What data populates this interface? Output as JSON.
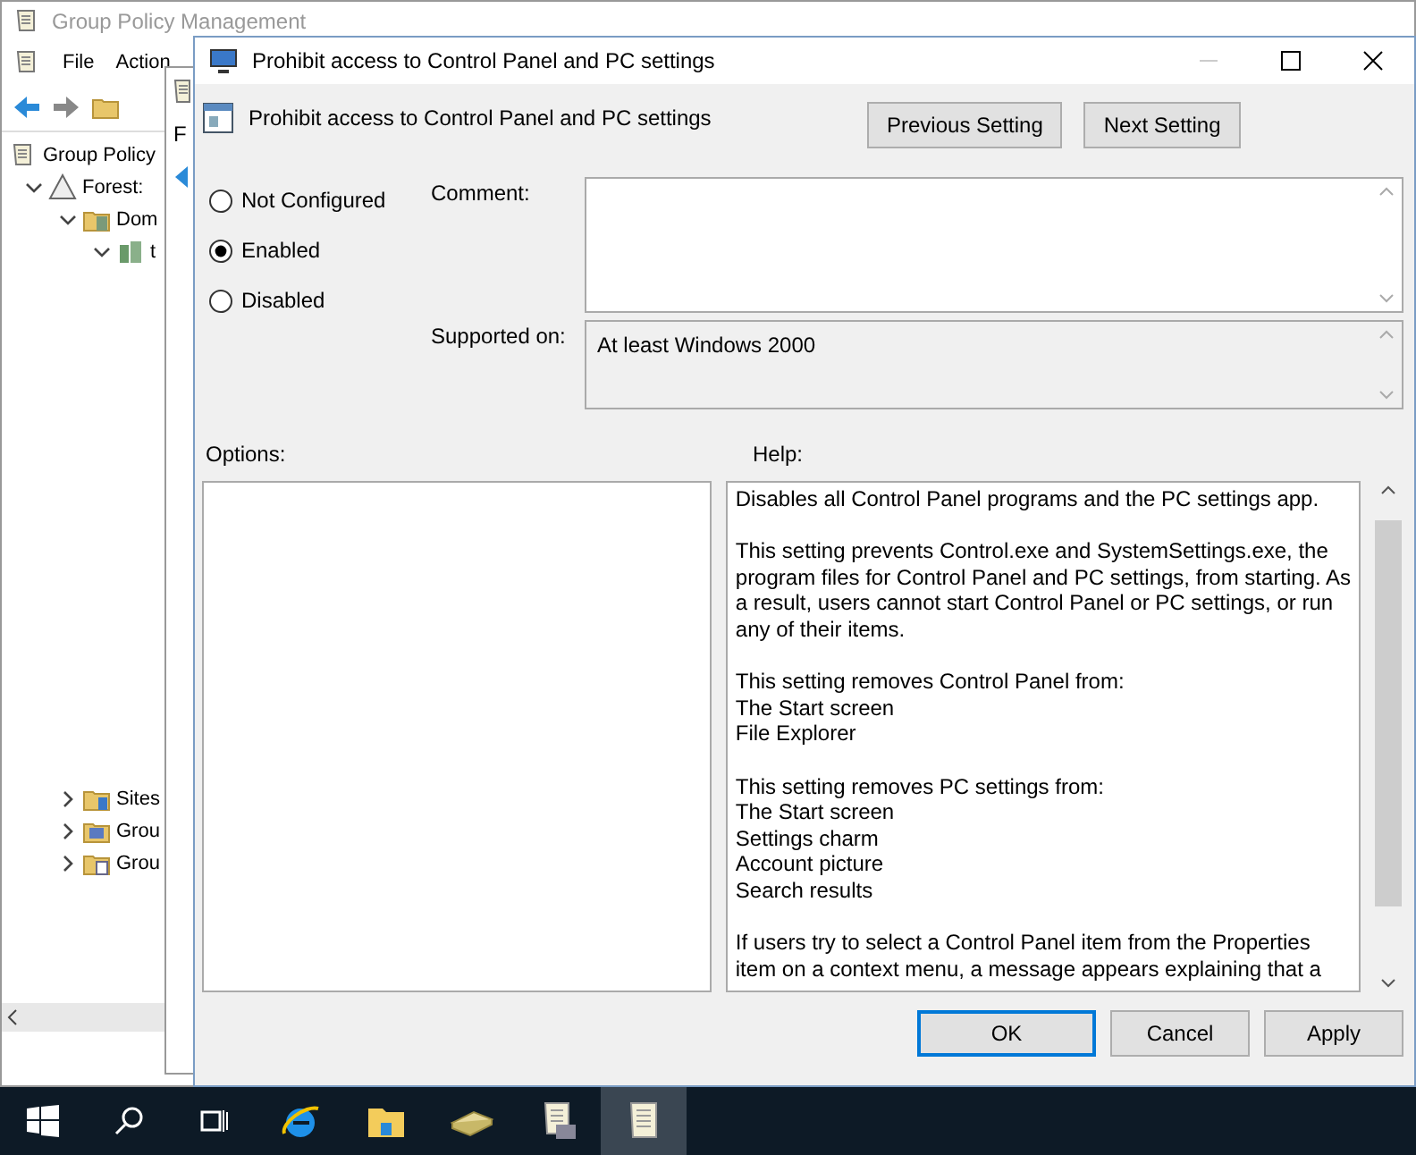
{
  "background_window": {
    "title": "Group Policy Management",
    "menu": [
      "File",
      "Action"
    ],
    "tree": [
      {
        "label": "Group Policy",
        "kind": "root",
        "children": [
          {
            "label": "Forest:",
            "kind": "forest",
            "expanded": true,
            "children": [
              {
                "label": "Dom",
                "kind": "domains",
                "expanded": true,
                "children": [
                  {
                    "label": "t",
                    "kind": "domain",
                    "expanded": true
                  }
                ]
              },
              {
                "label": "Sites",
                "kind": "sites",
                "expanded": false
              },
              {
                "label": "Grou",
                "kind": "modeling",
                "expanded": false
              },
              {
                "label": "Grou",
                "kind": "results",
                "expanded": false
              }
            ]
          }
        ]
      }
    ]
  },
  "middle_window": {
    "menu": [
      "F"
    ]
  },
  "dialog": {
    "title": "Prohibit access to Control Panel and PC settings",
    "setting_name": "Prohibit access to Control Panel and PC settings",
    "nav_buttons": [
      "Previous Setting",
      "Next Setting"
    ],
    "states": [
      {
        "label": "Not Configured",
        "selected": false
      },
      {
        "label": "Enabled",
        "selected": true
      },
      {
        "label": "Disabled",
        "selected": false
      }
    ],
    "comment": {
      "label": "Comment:"
    },
    "supported_on": {
      "label": "Supported on:",
      "value": "At least Windows 2000"
    },
    "options_label": "Options:",
    "help_label": "Help:",
    "help": [
      "Disables all Control Panel programs and the PC settings app.",
      "This setting prevents Control.exe and SystemSettings.exe, the program files for Control Panel and PC settings, from starting. As a result, users cannot start Control Panel or PC settings, or run any of their items.",
      "This setting removes Control Panel from:\nThe Start screen\nFile Explorer",
      "This setting removes PC settings from:\nThe Start screen\nSettings charm\nAccount picture\nSearch results",
      "If users try to select a Control Panel item from the Properties item on a context menu, a message appears explaining that a"
    ],
    "buttons": [
      {
        "label": "OK",
        "focused": true
      },
      {
        "label": "Cancel",
        "focused": false
      },
      {
        "label": "Apply",
        "focused": false
      }
    ]
  },
  "taskbar": {
    "items": [
      {
        "kind": "start",
        "selected": false
      },
      {
        "kind": "search",
        "selected": false
      },
      {
        "kind": "task-view",
        "selected": false
      },
      {
        "kind": "browser",
        "selected": false
      },
      {
        "kind": "folder",
        "selected": false
      },
      {
        "kind": "tool",
        "selected": false
      },
      {
        "kind": "console",
        "selected": false
      },
      {
        "kind": "scroll",
        "selected": true
      }
    ]
  }
}
